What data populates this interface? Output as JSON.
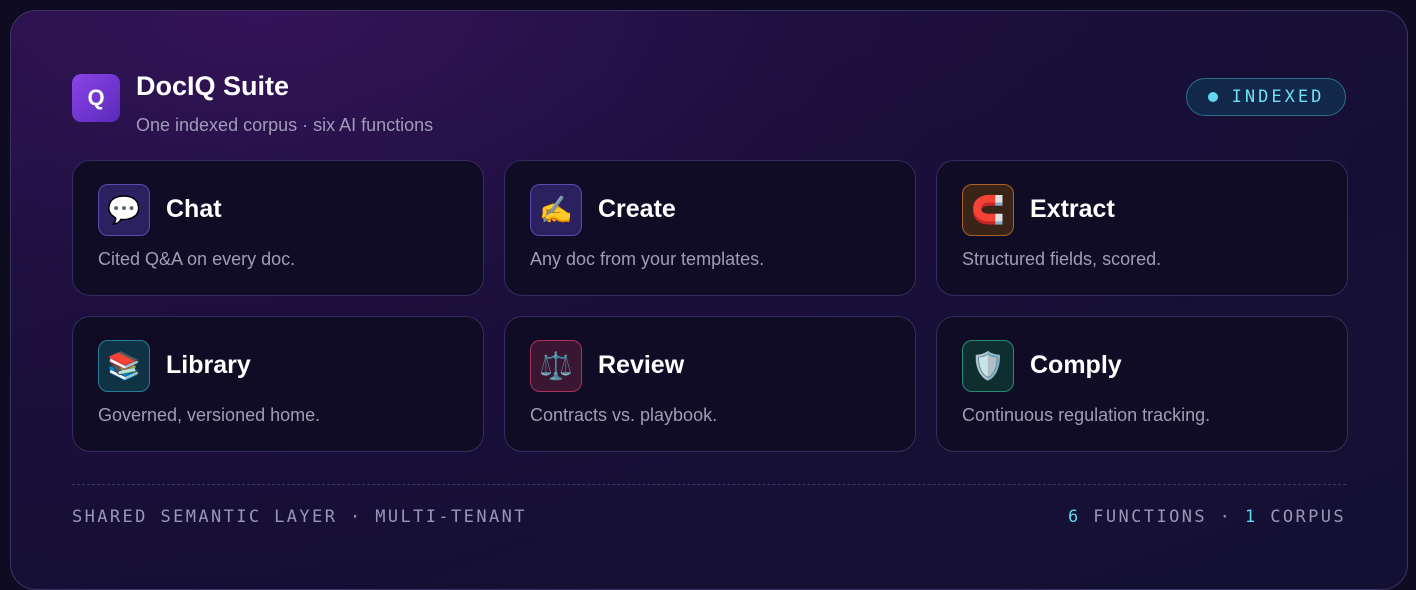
{
  "header": {
    "logo_letter": "Q",
    "title": "DocIQ Suite",
    "subtitle": "One indexed corpus · six AI functions",
    "status_badge": "INDEXED"
  },
  "cards": [
    {
      "title": "Chat",
      "description": "Cited Q&A on every doc.",
      "icon": "speech-bubble-icon",
      "emoji": "💬"
    },
    {
      "title": "Create",
      "description": "Any doc from your templates.",
      "icon": "writing-hand-icon",
      "emoji": "✍️"
    },
    {
      "title": "Extract",
      "description": "Structured fields, scored.",
      "icon": "magnet-icon",
      "emoji": "🧲"
    },
    {
      "title": "Library",
      "description": "Governed, versioned home.",
      "icon": "books-icon",
      "emoji": "📚"
    },
    {
      "title": "Review",
      "description": "Contracts vs. playbook.",
      "icon": "balance-scale-icon",
      "emoji": "⚖️"
    },
    {
      "title": "Comply",
      "description": "Continuous regulation tracking.",
      "icon": "shield-icon",
      "emoji": "🛡️"
    }
  ],
  "footer": {
    "left_text": "SHARED SEMANTIC LAYER · MULTI-TENANT",
    "functions_count": "6",
    "functions_label": "FUNCTIONS",
    "separator": "·",
    "corpus_count": "1",
    "corpus_label": "CORPUS"
  },
  "colors": {
    "accent_cyan": "#5fd8ee",
    "logo_purple": "#8b44e8",
    "background": "#170f36"
  }
}
